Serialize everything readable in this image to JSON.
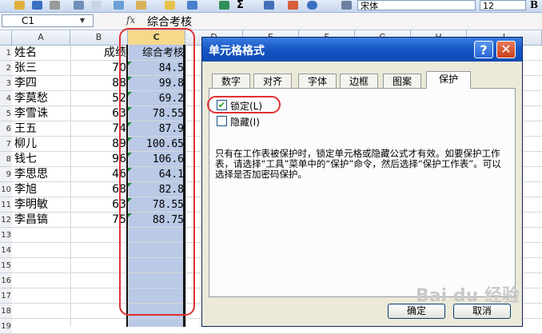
{
  "toolbar": {
    "font_name": "宋体",
    "font_size": "12",
    "bold_label": "B",
    "fx_label": "fx"
  },
  "formula_bar": {
    "name_box": "C1",
    "content": "综合考核"
  },
  "columns": [
    "A",
    "B",
    "C",
    "D",
    "E",
    "F",
    "G",
    "H",
    "I"
  ],
  "rows": [
    {
      "num": "1",
      "name": "姓名",
      "score": "成绩",
      "total": "综合考核"
    },
    {
      "num": "2",
      "name": "张三",
      "score": "70",
      "total": "84.5"
    },
    {
      "num": "3",
      "name": "李四",
      "score": "88",
      "total": "99.8"
    },
    {
      "num": "4",
      "name": "李莫愁",
      "score": "52",
      "total": "69.2"
    },
    {
      "num": "5",
      "name": "李雪诛",
      "score": "63",
      "total": "78.55"
    },
    {
      "num": "6",
      "name": "王五",
      "score": "74",
      "total": "87.9"
    },
    {
      "num": "7",
      "name": "柳儿",
      "score": "89",
      "total": "100.65"
    },
    {
      "num": "8",
      "name": "钱七",
      "score": "96",
      "total": "106.6"
    },
    {
      "num": "9",
      "name": "李思思",
      "score": "46",
      "total": "64.1"
    },
    {
      "num": "10",
      "name": "李旭",
      "score": "68",
      "total": "82.8"
    },
    {
      "num": "11",
      "name": "李明敏",
      "score": "63",
      "total": "78.55"
    },
    {
      "num": "12",
      "name": "李昌镐",
      "score": "75",
      "total": "88.75"
    },
    {
      "num": "13",
      "name": "",
      "score": "",
      "total": ""
    },
    {
      "num": "14",
      "name": "",
      "score": "",
      "total": ""
    },
    {
      "num": "15",
      "name": "",
      "score": "",
      "total": ""
    },
    {
      "num": "16",
      "name": "",
      "score": "",
      "total": ""
    },
    {
      "num": "17",
      "name": "",
      "score": "",
      "total": ""
    },
    {
      "num": "18",
      "name": "",
      "score": "",
      "total": ""
    },
    {
      "num": "19",
      "name": "",
      "score": "",
      "total": ""
    }
  ],
  "dialog": {
    "title": "单元格格式",
    "help": "?",
    "close": "✕",
    "tabs": [
      "数字",
      "对齐",
      "字体",
      "边框",
      "图案",
      "保护"
    ],
    "active_tab": "保护",
    "lock_label": "锁定(L)",
    "lock_checked": true,
    "hide_label": "隐藏(I)",
    "hide_checked": false,
    "info": "只有在工作表被保护时，锁定单元格或隐藏公式才有效。如要保护工作表，请选择“工具”菜单中的“保护”命令，然后选择“保护工作表”。可以选择是否加密码保护。",
    "ok_label": "确定",
    "cancel_label": "取消"
  },
  "watermark": "Bai du 经验",
  "colors": {
    "selection": "#b9c9e6",
    "annotation": "#e03030",
    "titlebar": "#1456c4"
  }
}
